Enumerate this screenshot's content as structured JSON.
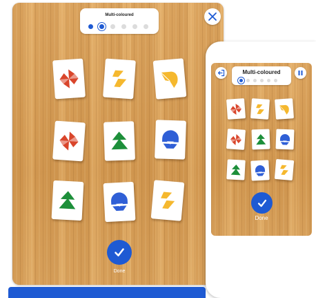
{
  "tablet": {
    "title": "Multi-coloured",
    "progress": {
      "total": 6,
      "completed_steps": 2,
      "current_step": 2
    },
    "close_icon": "close-icon",
    "cards": [
      {
        "row": 1,
        "col": 1,
        "icon": "pinwheel-icon",
        "color": "#d9452b"
      },
      {
        "row": 1,
        "col": 2,
        "icon": "zigzag-icon",
        "color": "#f5b82e"
      },
      {
        "row": 1,
        "col": 3,
        "icon": "leaf-icon",
        "color": "#f5b82e"
      },
      {
        "row": 2,
        "col": 1,
        "icon": "pinwheel-icon",
        "color": "#d9452b"
      },
      {
        "row": 2,
        "col": 2,
        "icon": "tree-icon",
        "color": "#1d8f3a"
      },
      {
        "row": 2,
        "col": 3,
        "icon": "dome-icon",
        "color": "#2f5fd6"
      },
      {
        "row": 3,
        "col": 1,
        "icon": "tree-icon",
        "color": "#1d8f3a"
      },
      {
        "row": 3,
        "col": 2,
        "icon": "dome-icon",
        "color": "#2f5fd6"
      },
      {
        "row": 3,
        "col": 3,
        "icon": "zigzag-icon",
        "color": "#f5b82e"
      }
    ],
    "done_label": "Done"
  },
  "phone": {
    "title": "Multi-coloured",
    "progress": {
      "total": 6,
      "completed_steps": 1,
      "current_step": 1
    },
    "exit_icon": "exit-icon",
    "pause_icon": "pause-icon",
    "cards": [
      {
        "row": 1,
        "col": 1,
        "icon": "pinwheel-icon",
        "color": "#d9452b"
      },
      {
        "row": 1,
        "col": 2,
        "icon": "zigzag-icon",
        "color": "#f5b82e"
      },
      {
        "row": 1,
        "col": 3,
        "icon": "leaf-icon",
        "color": "#f5b82e"
      },
      {
        "row": 2,
        "col": 1,
        "icon": "pinwheel-icon",
        "color": "#d9452b"
      },
      {
        "row": 2,
        "col": 2,
        "icon": "tree-icon",
        "color": "#1d8f3a"
      },
      {
        "row": 2,
        "col": 3,
        "icon": "dome-icon",
        "color": "#2f5fd6"
      },
      {
        "row": 3,
        "col": 1,
        "icon": "tree-icon",
        "color": "#1d8f3a"
      },
      {
        "row": 3,
        "col": 2,
        "icon": "dome-icon",
        "color": "#2f5fd6"
      },
      {
        "row": 3,
        "col": 3,
        "icon": "zigzag-icon",
        "color": "#f5b82e"
      }
    ],
    "done_label": "Done"
  },
  "colors": {
    "accent": "#1e5ad3",
    "red": "#d9452b",
    "yellow": "#f5b82e",
    "green": "#1d8f3a",
    "blue": "#2f5fd6",
    "wood": "#d9a15a"
  }
}
